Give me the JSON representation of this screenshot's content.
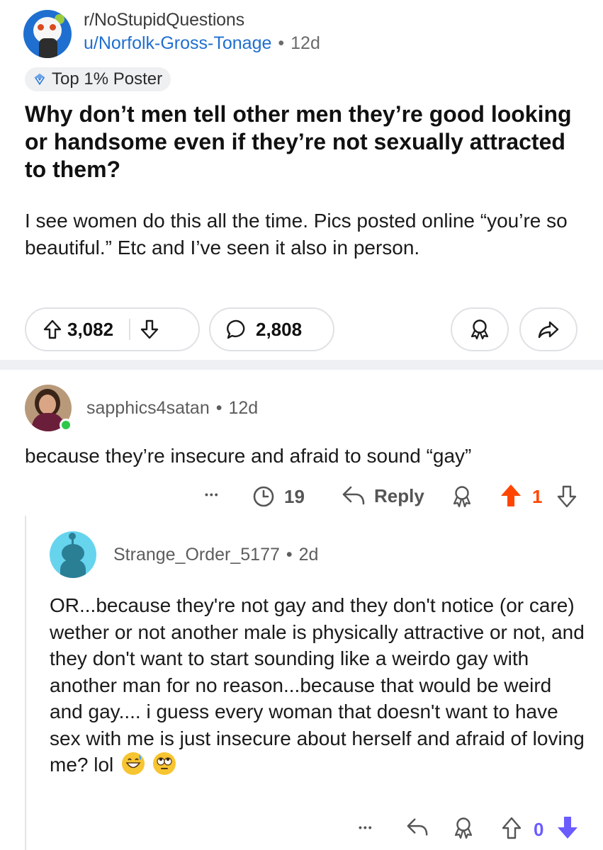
{
  "post": {
    "subreddit": "r/NoStupidQuestions",
    "author": "u/Norfolk-Gross-Tonage",
    "separator": "•",
    "age": "12d",
    "flair": "Top 1% Poster",
    "title": "Why don’t men tell other men they’re good looking or handsome even if they’re not sexually attracted to them?",
    "body": "I see women do this all the time. Pics posted online “you’re so beautiful.” Etc and I’ve seen it also in person.",
    "upvotes": "3,082",
    "comments": "2,808",
    "icons": {
      "upvote": "arrow-up-outline-icon",
      "downvote": "arrow-down-outline-icon",
      "comment": "speech-bubble-icon",
      "award": "award-ribbon-icon",
      "share": "share-arrow-icon"
    }
  },
  "comment1": {
    "username": "sapphics4satan",
    "separator": "•",
    "age": "12d",
    "text": "because they’re insecure and afraid to sound “gay”",
    "more": "•••",
    "reply_count_label": "19",
    "reply_label": "Reply",
    "score": "1",
    "upvoted": true,
    "colors": {
      "upvote_active": "#ff4500",
      "online": "#2ec94a"
    }
  },
  "comment2": {
    "username": "Strange_Order_5177",
    "separator": "•",
    "age": "2d",
    "text": "OR...because they're not gay and they don't notice (or care)  wether or not another male is physically attractive or not, and they don't want to start sounding like a weirdo gay with another man for no reason...because that would be weird and gay.... i guess every woman that doesn't want to have sex with me is just insecure about herself and afraid of loving me? lol",
    "emojis": [
      "grinning-sweat-emoji",
      "eye-roll-emoji"
    ],
    "more": "•••",
    "score": "0",
    "downvoted": true,
    "colors": {
      "downvote_active": "#6a5cff"
    }
  },
  "colors": {
    "link_blue": "#1f6fd0",
    "pill_border": "#dfe1e4",
    "divider": "#eef0f3"
  }
}
